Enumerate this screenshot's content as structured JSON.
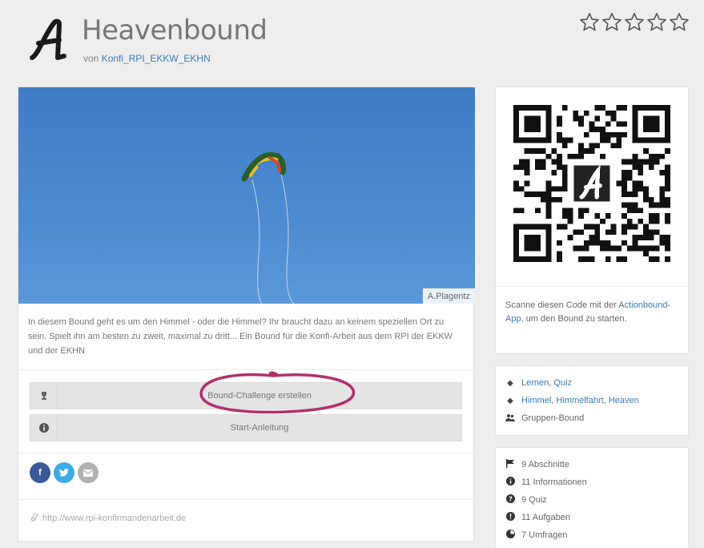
{
  "header": {
    "title": "Heavenbound",
    "by_prefix": "von",
    "author": "Konfi_RPI_EKKW_EKHN",
    "rating_stars": 5,
    "rating_filled": 0
  },
  "hero": {
    "credit": "A.Plagentz"
  },
  "description": "In diesem Bound geht es um den Himmel - oder die Himmel? Ihr braucht dazu an keinem speziellen Ort zu sein. Spielt ihn am besten zu zweit, maximal zu dritt... Ein Bound für die Konfi-Arbeit aus dem RPI der EKKW und der EKHN",
  "actions": [
    {
      "icon": "trophy-icon",
      "label": "Bound-Challenge erstellen"
    },
    {
      "icon": "info-icon",
      "label": "Start-Anleitung"
    }
  ],
  "share": [
    {
      "icon": "facebook-icon",
      "glyph": "f",
      "color": "#3b5998"
    },
    {
      "icon": "twitter-icon",
      "glyph": "t",
      "color": "#3fa9e6"
    },
    {
      "icon": "email-icon",
      "glyph": "✉",
      "color": "#aaaaaa"
    }
  ],
  "url": "http://www.rpi-konfirmandenarbeit.de",
  "qr": {
    "scan_prefix": "Scanne diesen Code mit der",
    "scan_link": "Actionbound-App",
    "scan_suffix": ", um den Bound zu starten."
  },
  "tags": {
    "categories": [
      "Lernen",
      "Quiz"
    ],
    "keywords": [
      "Himmel",
      "Himmelfahrt",
      "Heaven"
    ],
    "mode": "Gruppen-Bound"
  },
  "stats": [
    {
      "icon": "flag-icon",
      "glyph": "⚑",
      "text": "9 Abschnitte"
    },
    {
      "icon": "info-icon",
      "glyph": "i",
      "text": "11 Informationen"
    },
    {
      "icon": "question-icon",
      "glyph": "?",
      "text": "9 Quiz"
    },
    {
      "icon": "exclamation-icon",
      "glyph": "!",
      "text": "11 Aufgaben"
    },
    {
      "icon": "survey-icon",
      "glyph": "◔",
      "text": "7 Umfragen"
    }
  ],
  "colors": {
    "link": "#3a7ab8",
    "highlight": "#b0306e",
    "sky": "#4a88cf"
  }
}
